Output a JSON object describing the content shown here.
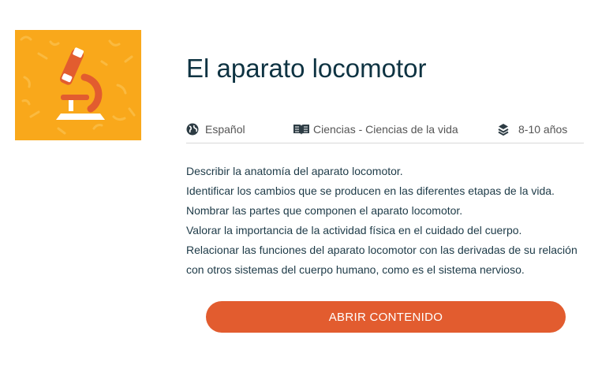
{
  "resource": {
    "title": "El aparato locomotor",
    "thumbnail_icon": "microscope-icon",
    "thumbnail_bg": "#f9a81b",
    "meta": {
      "language": "Español",
      "language_icon": "globe-icon",
      "subject": "Ciencias - Ciencias de la vida",
      "subject_icon": "open-book-icon",
      "age": "8-10 años",
      "age_icon": "layers-icon"
    },
    "objectives": [
      "Describir la anatomía del aparato locomotor.",
      "Identificar los cambios que se producen en las diferentes etapas de la vida.",
      "Nombrar las partes que componen el aparato locomotor.",
      "Valorar la importancia de la actividad física en el cuidado del cuerpo.",
      "Relacionar las funciones del aparato locomotor con las derivadas de su relación",
      "con otros sistemas del cuerpo humano, como es el sistema nervioso."
    ],
    "open_button_label": "ABRIR CONTENIDO",
    "accent_color": "#e25c2f"
  }
}
